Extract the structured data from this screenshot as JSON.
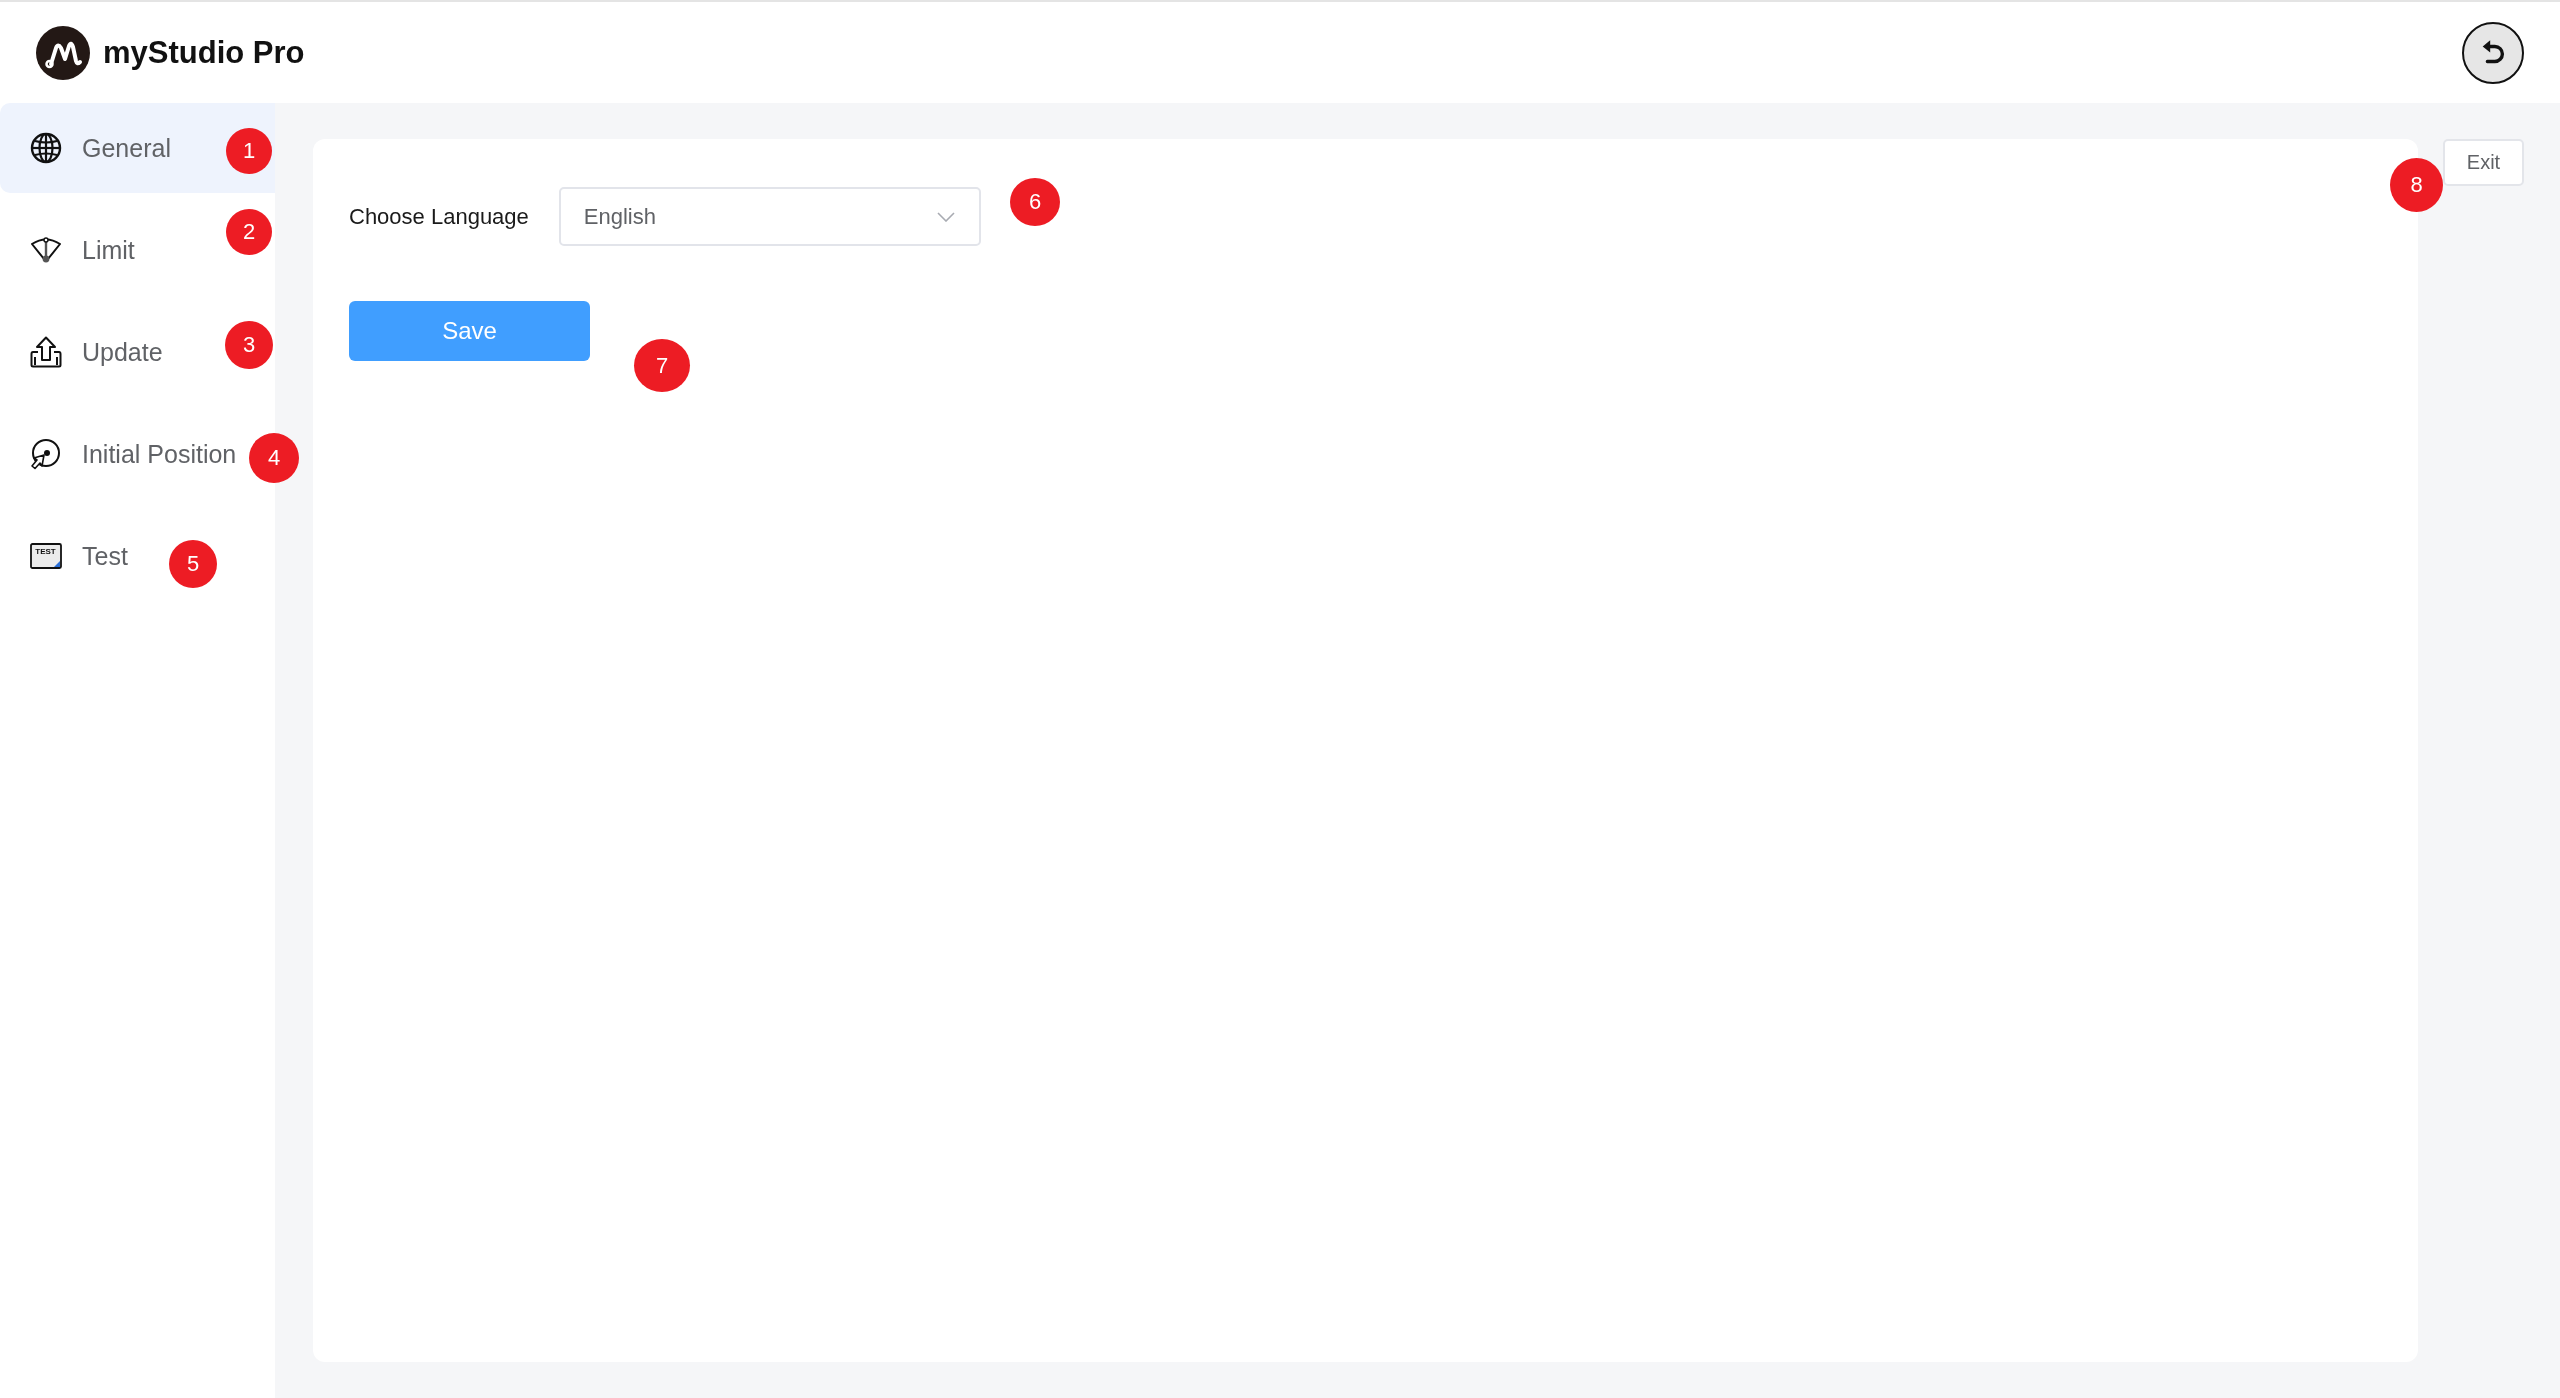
{
  "header": {
    "title": "myStudio Pro"
  },
  "sidebar": {
    "items": [
      {
        "label": "General",
        "selected": true
      },
      {
        "label": "Limit",
        "selected": false
      },
      {
        "label": "Update",
        "selected": false
      },
      {
        "label": "Initial Position",
        "selected": false
      },
      {
        "label": "Test",
        "selected": false,
        "icon_text": "TEST"
      }
    ]
  },
  "language": {
    "label": "Choose Language",
    "value": "English"
  },
  "save_button": "Save",
  "exit_button": "Exit",
  "callouts": [
    {
      "label": "1"
    },
    {
      "label": "2"
    },
    {
      "label": "3"
    },
    {
      "label": "4"
    },
    {
      "label": "5"
    },
    {
      "label": "6"
    },
    {
      "label": "7"
    },
    {
      "label": "8"
    }
  ]
}
